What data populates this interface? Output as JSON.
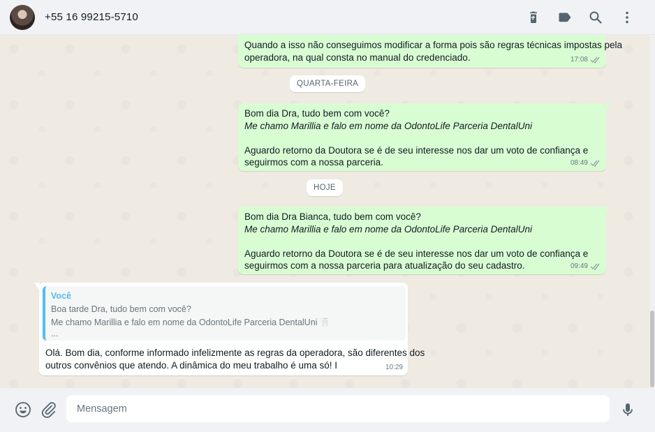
{
  "header": {
    "contact_name": "+55 16 99215-5710",
    "icons": [
      "delete-icon",
      "label-icon",
      "search-icon",
      "menu-icon"
    ]
  },
  "messages": [
    {
      "direction": "out",
      "lines": [
        {
          "text": "Quando a isso não conseguimos modificar a forma pois são regras técnicas impostas pela",
          "italic": false
        },
        {
          "text": "operadora, na qual consta no manual do credenciado.",
          "italic": false
        }
      ],
      "time": "17:08",
      "status": "read"
    },
    {
      "type": "day",
      "label": "QUARTA-FEIRA"
    },
    {
      "direction": "out",
      "lines": [
        {
          "text": "Bom dia Dra, tudo bem com você?",
          "italic": false
        },
        {
          "text": "Me chamo Marillia e falo em nome da OdontoLife Parceria DentalUni",
          "italic": true
        },
        {
          "text": "",
          "italic": false
        },
        {
          "text": "Aguardo retorno da Doutora se é de seu interesse nos dar um voto de confiança e",
          "italic": false
        },
        {
          "text": "seguirmos com a nossa parceria.",
          "italic": false
        }
      ],
      "time": "08:49",
      "status": "read"
    },
    {
      "type": "day",
      "label": "HOJE"
    },
    {
      "direction": "out",
      "lines": [
        {
          "text": "Bom dia Dra Bianca, tudo bem com você?",
          "italic": false
        },
        {
          "text": "Me chamo Marillia e falo em nome da OdontoLife Parceria DentalUni",
          "italic": true
        },
        {
          "text": "",
          "italic": false
        },
        {
          "text": "Aguardo retorno da Doutora se é de seu interesse nos dar um voto de confiança e",
          "italic": false
        },
        {
          "text": "seguirmos com a nossa parceria para atualização do seu cadastro.",
          "italic": false
        }
      ],
      "time": "09:49",
      "status": "read"
    },
    {
      "direction": "in",
      "quote": {
        "author": "Você",
        "lines": [
          "Boa tarde Dra, tudo bem com você?",
          "Me chamo Marillia e falo em nome da OdontoLife Parceria DentalUni 🦷",
          "..."
        ]
      },
      "lines": [
        {
          "text": "Olá.  Bom dia, conforme informado infelizmente as regras da operadora, são diferentes dos",
          "italic": false
        },
        {
          "text": "outros convênios que atendo. A dinâmica do meu trabalho é uma só! I",
          "italic": false
        }
      ],
      "time": "10:29"
    }
  ],
  "footer": {
    "placeholder": "Mensagem",
    "value": ""
  },
  "colors": {
    "outgoing_bubble": "#d9fdd3",
    "incoming_bubble": "#ffffff",
    "chat_background": "#efeae2",
    "quote_accent": "#53bdeb",
    "read_ticks": "#8696a0"
  }
}
